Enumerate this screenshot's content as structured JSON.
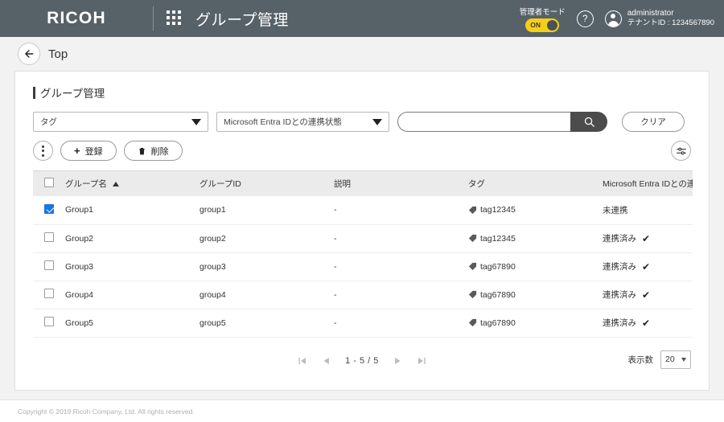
{
  "header": {
    "brand": "RICOH",
    "apps_icon": "apps-grid-icon",
    "title": "グループ管理",
    "admin_mode_label": "管理者モード",
    "toggle_state": "ON",
    "toggle_color": "#f5cf16",
    "help_icon": "?",
    "user_name": "administrator",
    "user_tenant": "テナントID : 1234567890",
    "background_color": "#566268"
  },
  "breadcrumb": {
    "back_icon": "back-arrow-icon",
    "label": "Top"
  },
  "page": {
    "section_title": "グループ管理"
  },
  "filters": {
    "tag_select": "タグ",
    "entra_select": "Microsoft Entra IDとの連携状態",
    "search_value": "",
    "search_placeholder": "",
    "search_icon": "search-icon",
    "clear_label": "クリア"
  },
  "toolbar": {
    "kebab_icon": "more-vertical-icon",
    "register_label": "登録",
    "register_icon": "+",
    "delete_label": "削除",
    "delete_icon": "trash-icon",
    "settings_icon": "sliders-icon"
  },
  "table": {
    "select_all_checked": false,
    "columns": [
      {
        "key": "name",
        "label": "グループ名",
        "sort": "asc"
      },
      {
        "key": "id",
        "label": "グループID",
        "sort": ""
      },
      {
        "key": "desc",
        "label": "説明",
        "sort": ""
      },
      {
        "key": "tag",
        "label": "タグ",
        "sort": ""
      },
      {
        "key": "entra",
        "label": "Microsoft Entra IDとの連携状態",
        "sort": ""
      }
    ],
    "rows": [
      {
        "checked": true,
        "name": "Group1",
        "id": "group1",
        "desc": "-",
        "tag": "tag12345",
        "entra": "未連携",
        "linked": false
      },
      {
        "checked": false,
        "name": "Group2",
        "id": "group2",
        "desc": "-",
        "tag": "tag12345",
        "entra": "連携済み",
        "linked": true
      },
      {
        "checked": false,
        "name": "Group3",
        "id": "group3",
        "desc": "-",
        "tag": "tag67890",
        "entra": "連携済み",
        "linked": true
      },
      {
        "checked": false,
        "name": "Group4",
        "id": "group4",
        "desc": "-",
        "tag": "tag67890",
        "entra": "連携済み",
        "linked": true
      },
      {
        "checked": false,
        "name": "Group5",
        "id": "group5",
        "desc": "-",
        "tag": "tag67890",
        "entra": "連携済み",
        "linked": true
      }
    ]
  },
  "pagination": {
    "first_icon": "first-page-icon",
    "prev_icon": "prev-page-icon",
    "range_text": "1 - 5 / 5",
    "next_icon": "next-page-icon",
    "last_icon": "last-page-icon",
    "rows_label": "表示数",
    "rows_value": "20",
    "rows_options": [
      "20"
    ]
  },
  "footer": {
    "copyright": "Copyright © 2019 Ricoh Company, Ltd. All rights reserved."
  }
}
